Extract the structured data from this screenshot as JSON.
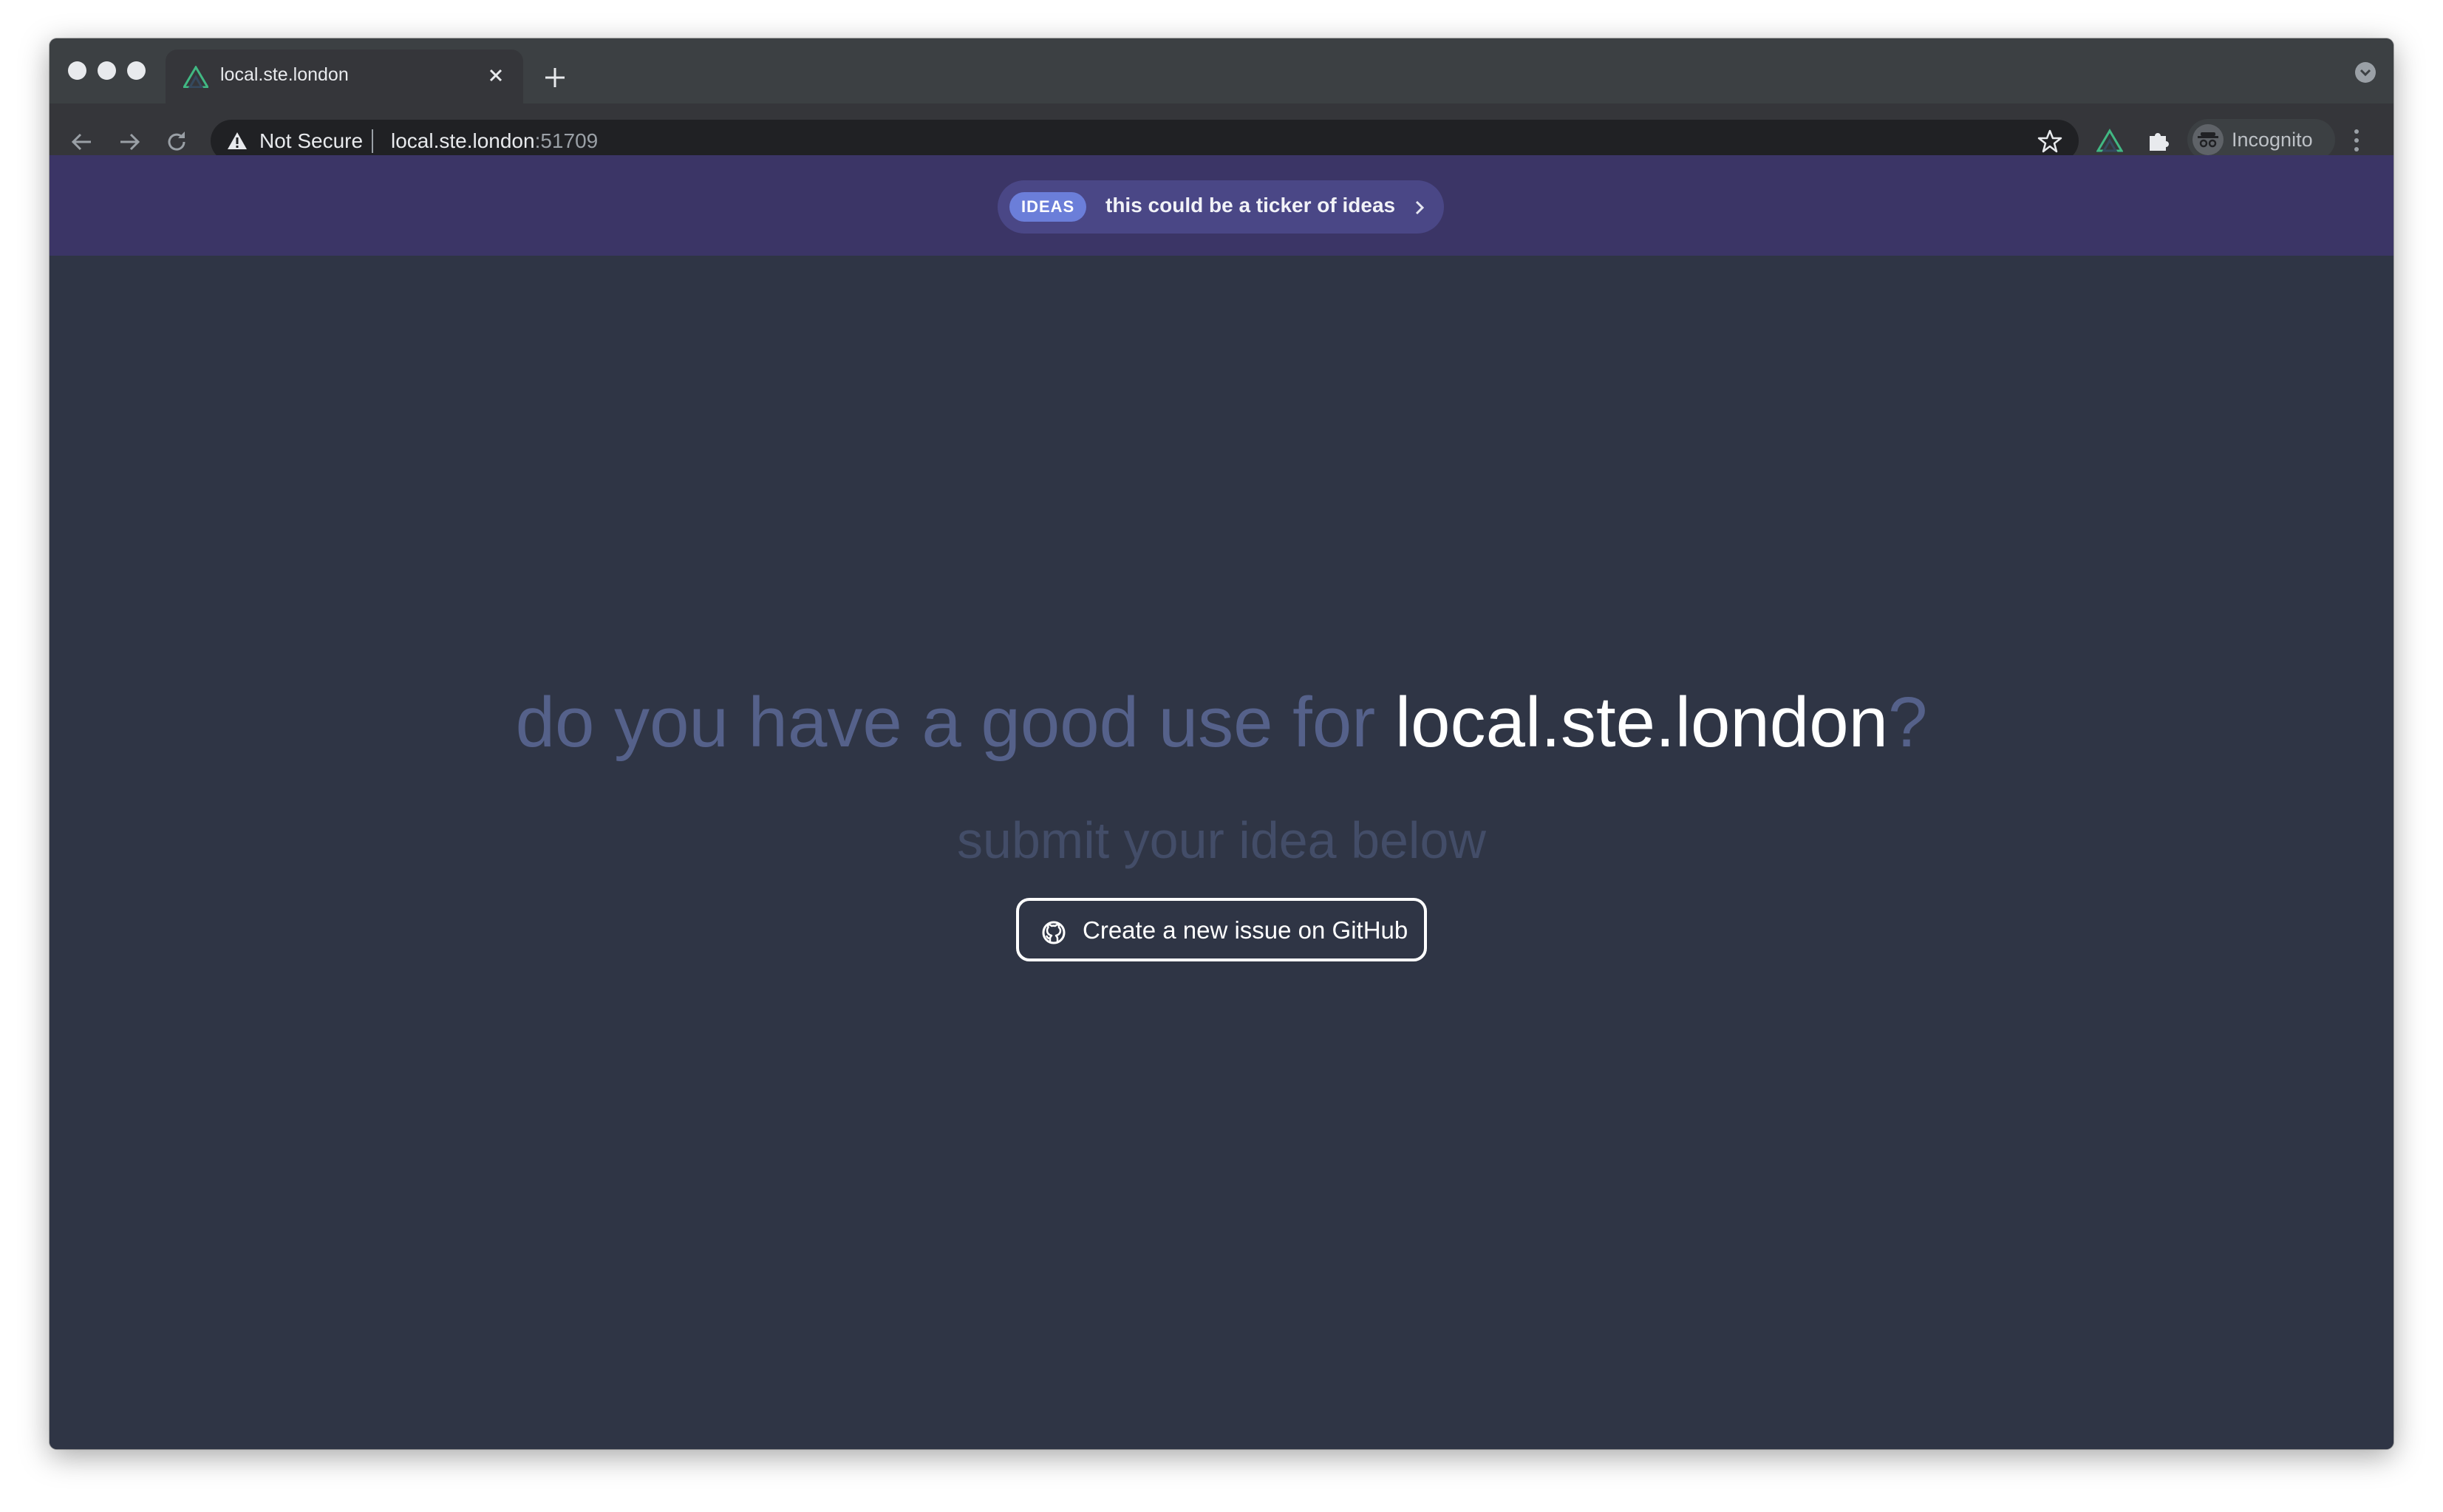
{
  "browser": {
    "tab": {
      "title": "local.ste.london",
      "favicon": "vue-logo-icon"
    },
    "address_bar": {
      "security_label": "Not Secure",
      "host": "local.ste.london",
      "port": ":51709"
    },
    "profile": {
      "label": "Incognito"
    }
  },
  "banner": {
    "badge": "IDEAS",
    "text": "this could be a ticker of ideas"
  },
  "hero": {
    "question_prefix": "do you have a good use for ",
    "domain": "local.ste.london",
    "question_suffix": "?",
    "subtitle": "submit your idea below",
    "button_label": "Create a new issue on GitHub"
  },
  "colors": {
    "page_background": "#2f3545",
    "banner_background": "#3b3566",
    "ticker_background": "#4a4786",
    "badge_background": "#6b7ed9",
    "headline_muted": "#55618a",
    "subtitle_muted": "#434d68",
    "accent_white": "#ffffff"
  }
}
